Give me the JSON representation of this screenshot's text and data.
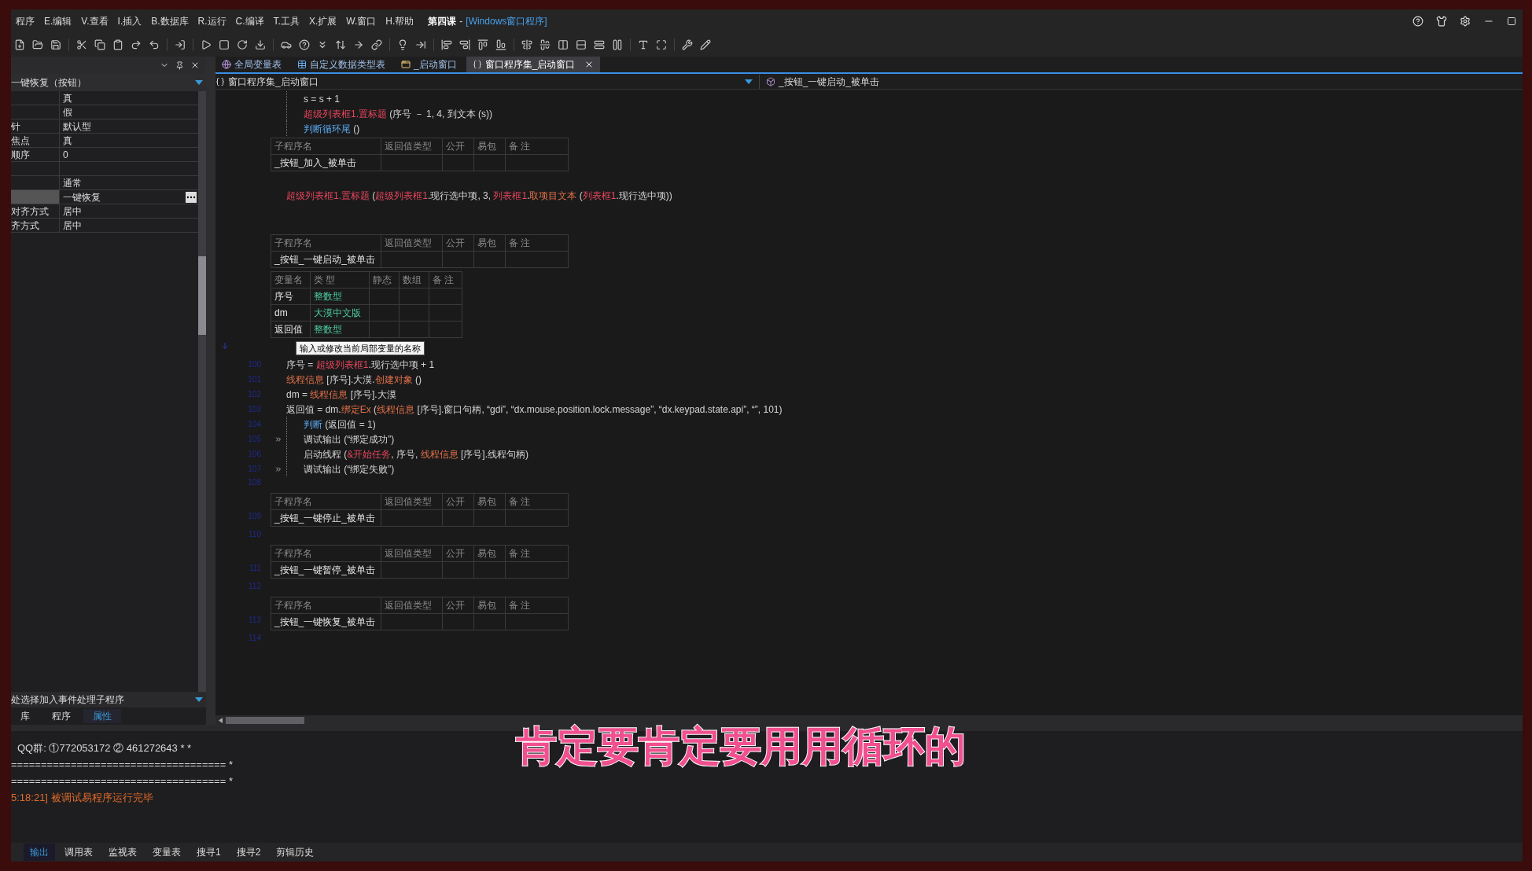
{
  "menu": [
    "程序",
    "E.编辑",
    "V.查看",
    "I.插入",
    "B.数据库",
    "R.运行",
    "C.编译",
    "T.工具",
    "X.扩展",
    "W.窗口",
    "H.帮助"
  ],
  "window": {
    "title": "第四课",
    "separator": "-",
    "subtitle": "[Windows窗口程序]"
  },
  "properties": {
    "header": "一键恢复（按钮）",
    "rows": [
      {
        "name": "",
        "value": "真",
        "selected": false,
        "has_button": false
      },
      {
        "name": "",
        "value": "假",
        "selected": false,
        "has_button": false
      },
      {
        "name": "针",
        "value": "默认型",
        "selected": false,
        "has_button": false
      },
      {
        "name": "焦点",
        "value": "真",
        "selected": false,
        "has_button": false
      },
      {
        "name": "顺序",
        "value": "0",
        "selected": false,
        "has_button": false
      },
      {
        "name": "",
        "value": "",
        "selected": false,
        "has_button": false
      },
      {
        "name": "",
        "value": "通常",
        "selected": false,
        "has_button": false
      },
      {
        "name": "",
        "value": "一键恢复",
        "selected": true,
        "has_button": true
      },
      {
        "name": "对齐方式",
        "value": "居中",
        "selected": false,
        "has_button": false
      },
      {
        "name": "齐方式",
        "value": "居中",
        "selected": false,
        "has_button": false
      }
    ],
    "event_hint": "处选择加入事件处理子程序",
    "tabs": [
      {
        "label": "库",
        "selected": false
      },
      {
        "label": "程序",
        "selected": false
      },
      {
        "label": "属性",
        "selected": true
      }
    ]
  },
  "editor_tabs": [
    {
      "label": "全局变量表",
      "kind": "globals",
      "selected": false
    },
    {
      "label": "自定义数据类型表",
      "kind": "types",
      "selected": false
    },
    {
      "label": "_启动窗口",
      "kind": "window",
      "selected": false
    },
    {
      "label": "窗口程序集_启动窗口",
      "kind": "code",
      "selected": true
    }
  ],
  "nav": {
    "left": "窗口程序集_启动窗口",
    "right": "_按钮_一键启动_被单击"
  },
  "code": [
    {
      "kind": "block",
      "lines": [
        {
          "segments": [
            {
              "kind": "plain",
              "text": "s = s + 1"
            }
          ]
        },
        {
          "segments": [
            {
              "kind": "object",
              "text": "超级列表框1.置标题"
            },
            {
              "kind": "plain",
              "text": " (序号 － 1, 4, 到文本 (s))"
            }
          ]
        }
      ],
      "tail": {
        "segments": [
          {
            "kind": "keyword",
            "text": "判断循环尾"
          },
          {
            "kind": "plain",
            "text": " ()"
          }
        ]
      }
    },
    {
      "kind": "table",
      "columns": [
        "子程序名",
        "返回值类型",
        "公开",
        "易包",
        "备 注"
      ],
      "rows": [
        {
          "cells": [
            "_按钮_加入_被单击"
          ]
        }
      ]
    },
    {
      "kind": "blank"
    },
    {
      "kind": "line",
      "segments": [
        {
          "kind": "object",
          "text": "超级列表框1.置标题"
        },
        {
          "kind": "plain",
          "text": " ("
        },
        {
          "kind": "object",
          "text": "超级列表框1"
        },
        {
          "kind": "plain",
          "text": ".现行选中项, 3, "
        },
        {
          "kind": "object",
          "text": "列表框1"
        },
        {
          "kind": "plain",
          "text": "."
        },
        {
          "kind": "method",
          "text": "取项目文本"
        },
        {
          "kind": "plain",
          "text": " ("
        },
        {
          "kind": "object",
          "text": "列表框1"
        },
        {
          "kind": "plain",
          "text": ".现行选中项))"
        }
      ]
    },
    {
      "kind": "blank"
    },
    {
      "kind": "blank"
    },
    {
      "kind": "table",
      "columns": [
        "子程序名",
        "返回值类型",
        "公开",
        "易包",
        "备 注"
      ],
      "rows": [
        {
          "cells": [
            "_按钮_一键启动_被单击"
          ]
        }
      ]
    },
    {
      "kind": "vars",
      "columns": [
        "变量名",
        "类 型",
        "静态",
        "数组",
        "备 注"
      ],
      "rows": [
        {
          "cells": [
            "序号",
            "整数型"
          ]
        },
        {
          "cells": [
            "dm",
            "大漠中文版"
          ]
        },
        {
          "cells": [
            "返回值",
            "整数型"
          ]
        }
      ]
    },
    {
      "kind": "tooltip",
      "text": "输入或修改当前局部变量的名称"
    },
    {
      "kind": "line",
      "number": "100",
      "segments": [
        {
          "kind": "plain",
          "text": "序号 = "
        },
        {
          "kind": "object",
          "text": "超级列表框1"
        },
        {
          "kind": "plain",
          "text": ".现行选中项 + 1"
        }
      ]
    },
    {
      "kind": "line",
      "number": "101",
      "segments": [
        {
          "kind": "method",
          "text": "线程信息"
        },
        {
          "kind": "plain",
          "text": " [序号].大漠."
        },
        {
          "kind": "method",
          "text": "创建对象"
        },
        {
          "kind": "plain",
          "text": " ()"
        }
      ]
    },
    {
      "kind": "line",
      "number": "102",
      "segments": [
        {
          "kind": "plain",
          "text": "dm = "
        },
        {
          "kind": "method",
          "text": "线程信息"
        },
        {
          "kind": "plain",
          "text": " [序号].大漠"
        }
      ]
    },
    {
      "kind": "line",
      "number": "103",
      "segments": [
        {
          "kind": "plain",
          "text": "返回值 = dm."
        },
        {
          "kind": "method",
          "text": "绑定Ex"
        },
        {
          "kind": "plain",
          "text": " ("
        },
        {
          "kind": "method",
          "text": "线程信息"
        },
        {
          "kind": "plain",
          "text": " [序号].窗口句柄, “gdi”, “dx.mouse.position.lock.message”, “dx.keypad.state.api”, “”, 101)"
        }
      ]
    },
    {
      "kind": "block",
      "lines": [
        {
          "number": "104",
          "marked": false,
          "segments": [
            {
              "kind": "keyword",
              "text": "判断"
            },
            {
              "kind": "plain",
              "text": " (返回值 = 1)"
            }
          ]
        },
        {
          "number": "105",
          "marked": true,
          "segments": [
            {
              "kind": "plain",
              "text": "调试输出 (“绑定成功”)"
            }
          ]
        },
        {
          "number": "106",
          "marked": false,
          "segments": [
            {
              "kind": "plain",
              "text": "启动线程 ("
            },
            {
              "kind": "object",
              "text": "&开始任务"
            },
            {
              "kind": "plain",
              "text": ", 序号, "
            },
            {
              "kind": "method",
              "text": "线程信息"
            },
            {
              "kind": "plain",
              "text": " [序号].线程句柄)"
            }
          ]
        },
        {
          "number": "107",
          "marked": true,
          "segments": [
            {
              "kind": "plain",
              "text": "调试输出 (“绑定失败”)"
            }
          ]
        }
      ]
    },
    {
      "kind": "blank",
      "number": "108"
    },
    {
      "kind": "table",
      "number": "109",
      "columns": [
        "子程序名",
        "返回值类型",
        "公开",
        "易包",
        "备 注"
      ],
      "rows": [
        {
          "cells": [
            "_按钮_一键停止_被单击"
          ]
        }
      ]
    },
    {
      "kind": "blank",
      "number": "110"
    },
    {
      "kind": "table",
      "number": "111",
      "columns": [
        "子程序名",
        "返回值类型",
        "公开",
        "易包",
        "备 注"
      ],
      "rows": [
        {
          "cells": [
            "_按钮_一键暂停_被单击"
          ]
        }
      ]
    },
    {
      "kind": "blank",
      "number": "112"
    },
    {
      "kind": "table",
      "number": "113",
      "columns": [
        "子程序名",
        "返回值类型",
        "公开",
        "易包",
        "备 注"
      ],
      "rows": [
        {
          "cells": [
            "_按钮_一键恢复_被单击"
          ]
        }
      ]
    },
    {
      "kind": "blank",
      "number": "114"
    }
  ],
  "output": [
    {
      "kind": "plain",
      "text": "QQ群: ①772053172 ② 461272643 * *"
    },
    {
      "kind": "plain",
      "text": "==================================== *"
    },
    {
      "kind": "plain",
      "text": "==================================== *"
    },
    {
      "kind": "status",
      "text": "5:18:21] 被调试易程序运行完毕"
    }
  ],
  "output_tabs": [
    {
      "label": "输出",
      "selected": true
    },
    {
      "label": "调用表",
      "selected": false
    },
    {
      "label": "监视表",
      "selected": false
    },
    {
      "label": "变量表",
      "selected": false
    },
    {
      "label": "搜寻1",
      "selected": false
    },
    {
      "label": "搜寻2",
      "selected": false
    },
    {
      "label": "剪辑历史",
      "selected": false
    }
  ],
  "caption": "肯定要肯定要用用循环的"
}
